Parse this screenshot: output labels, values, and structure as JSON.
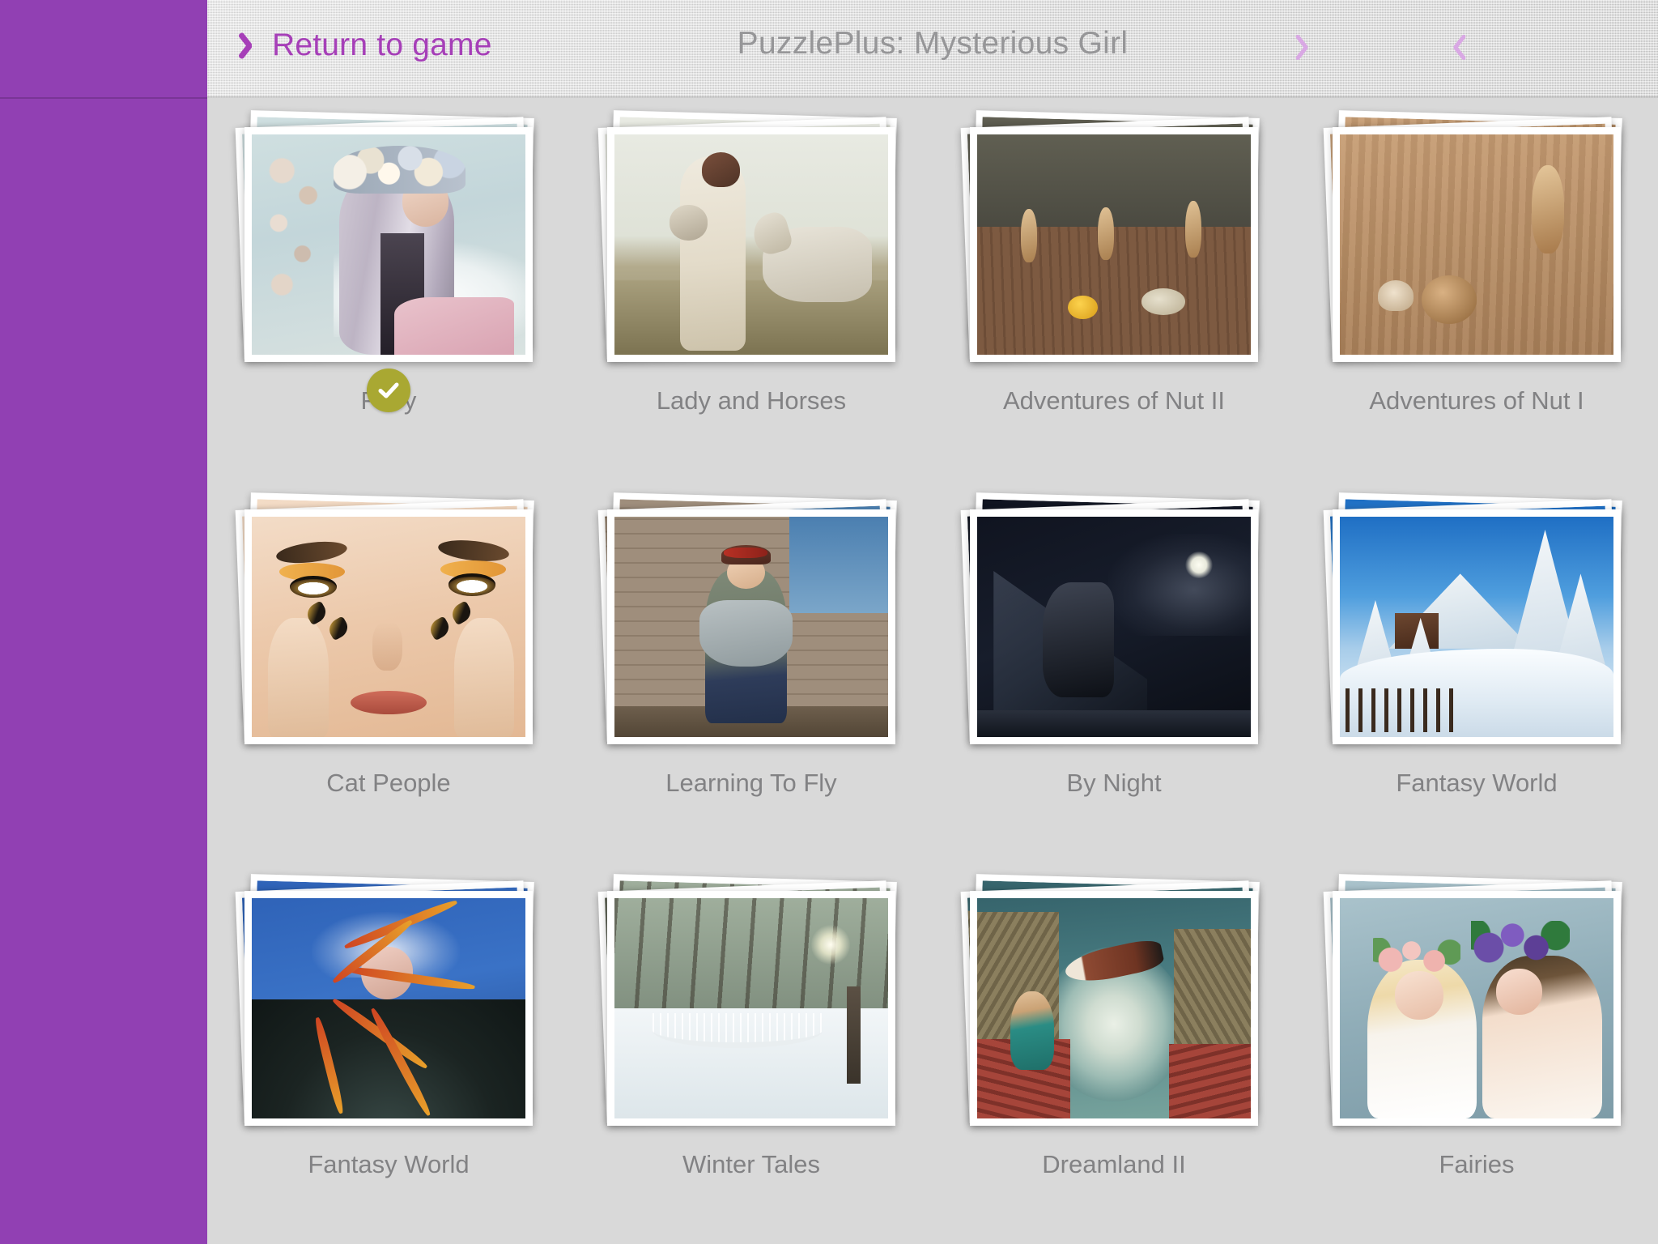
{
  "app": {
    "sidebar_color": "#9140b3",
    "background_color": "#d9d9d9",
    "accent_color": "#a63fb8",
    "accent_muted_color": "#d9a8e4",
    "label_color": "#828284",
    "title_color": "#969698",
    "badge_color": "#a9a832"
  },
  "header": {
    "back_label": "Return to game",
    "title": "PuzzlePlus: Mysterious Girl",
    "back_icon": "chevron-left-icon",
    "prev_icon": "chevron-left-icon",
    "next_icon": "chevron-right-icon",
    "refresh_icon": "refresh-icon"
  },
  "grid": {
    "columns": 4,
    "rows": 3,
    "selected_index": 0,
    "selected_badge_icon": "check-icon",
    "items": [
      {
        "label": "Fairy",
        "scene": "s-fairy",
        "selected": true
      },
      {
        "label": "Lady and Horses",
        "scene": "s-lady",
        "selected": false
      },
      {
        "label": "Adventures of Nut II",
        "scene": "s-nut2",
        "selected": false
      },
      {
        "label": "Adventures of Nut I",
        "scene": "s-nut1",
        "selected": false
      },
      {
        "label": "Cat People",
        "scene": "s-cat",
        "selected": false
      },
      {
        "label": "Learning To Fly",
        "scene": "s-fly",
        "selected": false
      },
      {
        "label": "By Night",
        "scene": "s-night",
        "selected": false
      },
      {
        "label": "Fantasy World",
        "scene": "s-winter",
        "selected": false
      },
      {
        "label": "Fantasy World",
        "scene": "s-paint",
        "selected": false
      },
      {
        "label": "Winter Tales",
        "scene": "s-wtales",
        "selected": false
      },
      {
        "label": "Dreamland II",
        "scene": "s-dream",
        "selected": false
      },
      {
        "label": "Fairies",
        "scene": "s-fairies",
        "selected": false
      }
    ]
  }
}
